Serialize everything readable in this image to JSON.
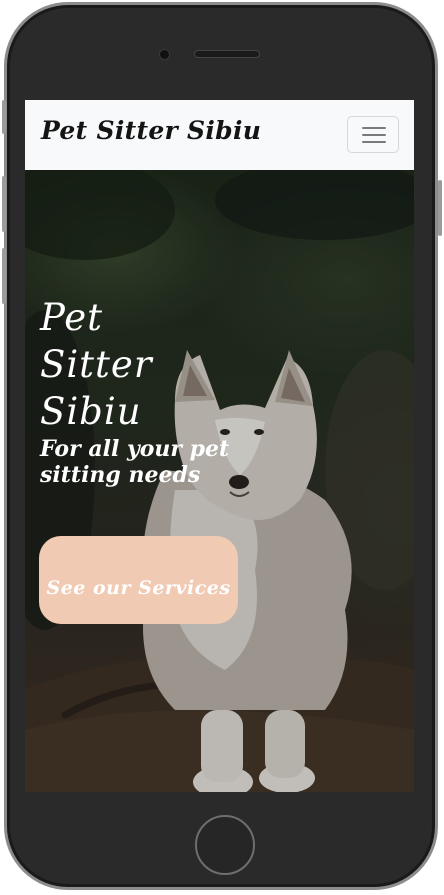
{
  "navbar": {
    "brand": "Pet Sitter Sibiu",
    "toggler_icon": "hamburger-icon"
  },
  "hero": {
    "title": "Pet Sitter Sibiu",
    "subtitle": "For all your pet sitting needs",
    "cta_label": "See our Services",
    "cta_color": "#f1cab3",
    "background_image": "husky-dog-in-forest"
  },
  "device": {
    "frame_color": "#2a2a2a"
  }
}
